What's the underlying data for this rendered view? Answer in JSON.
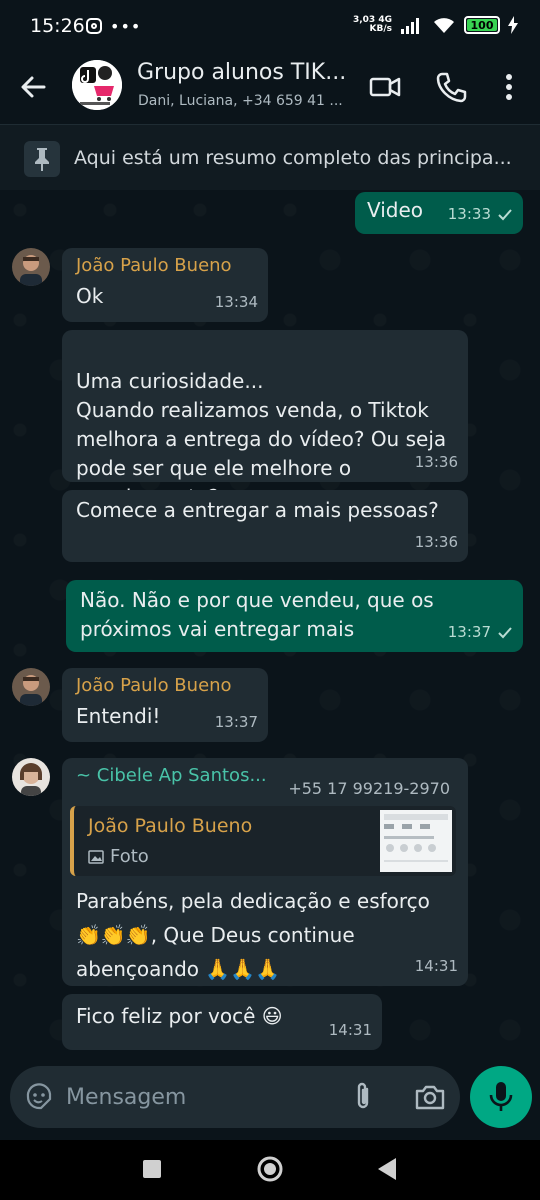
{
  "status": {
    "time": "15:26",
    "network_speed_value": "3,03",
    "network_speed_unit": "KB/s",
    "network_type": "4G",
    "battery": "100"
  },
  "header": {
    "title": "Grupo alunos TIK...",
    "subtitle": "Dani, Luciana, +34 659 41 ..."
  },
  "pinned": {
    "text": "Aqui está um resumo completo das principa..."
  },
  "messages": [
    {
      "type": "out",
      "text": "Video",
      "time": "13:33"
    },
    {
      "type": "in",
      "sender": "João Paulo Bueno",
      "text": "Ok",
      "time": "13:34"
    },
    {
      "type": "in",
      "text": "Uma curiosidade...\nQuando realizamos venda, o Tiktok melhora a entrega do vídeo? Ou seja pode ser que ele melhore o engajamento?",
      "time": "13:36"
    },
    {
      "type": "in",
      "text": "Comece a entregar a mais pessoas?",
      "time": "13:36"
    },
    {
      "type": "out",
      "text": "Não. Não e por que vendeu, que os próximos vai entregar mais",
      "time": "13:37"
    },
    {
      "type": "in",
      "sender": "João Paulo Bueno",
      "text": "Entendi!",
      "time": "13:37"
    },
    {
      "type": "in",
      "sender": "~ Cibele Ap Santos...",
      "phone": "+55 17 99219-2970",
      "quote_sender": "João Paulo Bueno",
      "quote_type": "Foto",
      "text": "Parabéns, pela dedicação e esforço 👏👏👏, Que Deus continue abençoando 🙏🙏🙏",
      "time": "14:31"
    },
    {
      "type": "in",
      "text": "Fico feliz por você 😃",
      "time": "14:31"
    }
  ],
  "composer": {
    "placeholder": "Mensagem"
  },
  "colors": {
    "background": "#0b141a",
    "incoming_bubble": "#202c33",
    "outgoing_bubble": "#005c4b",
    "accent": "#00a884",
    "sender_name": "#d7a24a",
    "sender_name_alt": "#49c3a8"
  },
  "icons": {
    "back": "arrow-left-icon",
    "video_call": "video-camera-icon",
    "voice_call": "phone-icon",
    "menu": "more-vertical-icon",
    "pin": "pin-icon",
    "sticker": "sticker-icon",
    "attach": "paperclip-icon",
    "camera": "camera-icon",
    "mic": "microphone-icon"
  }
}
